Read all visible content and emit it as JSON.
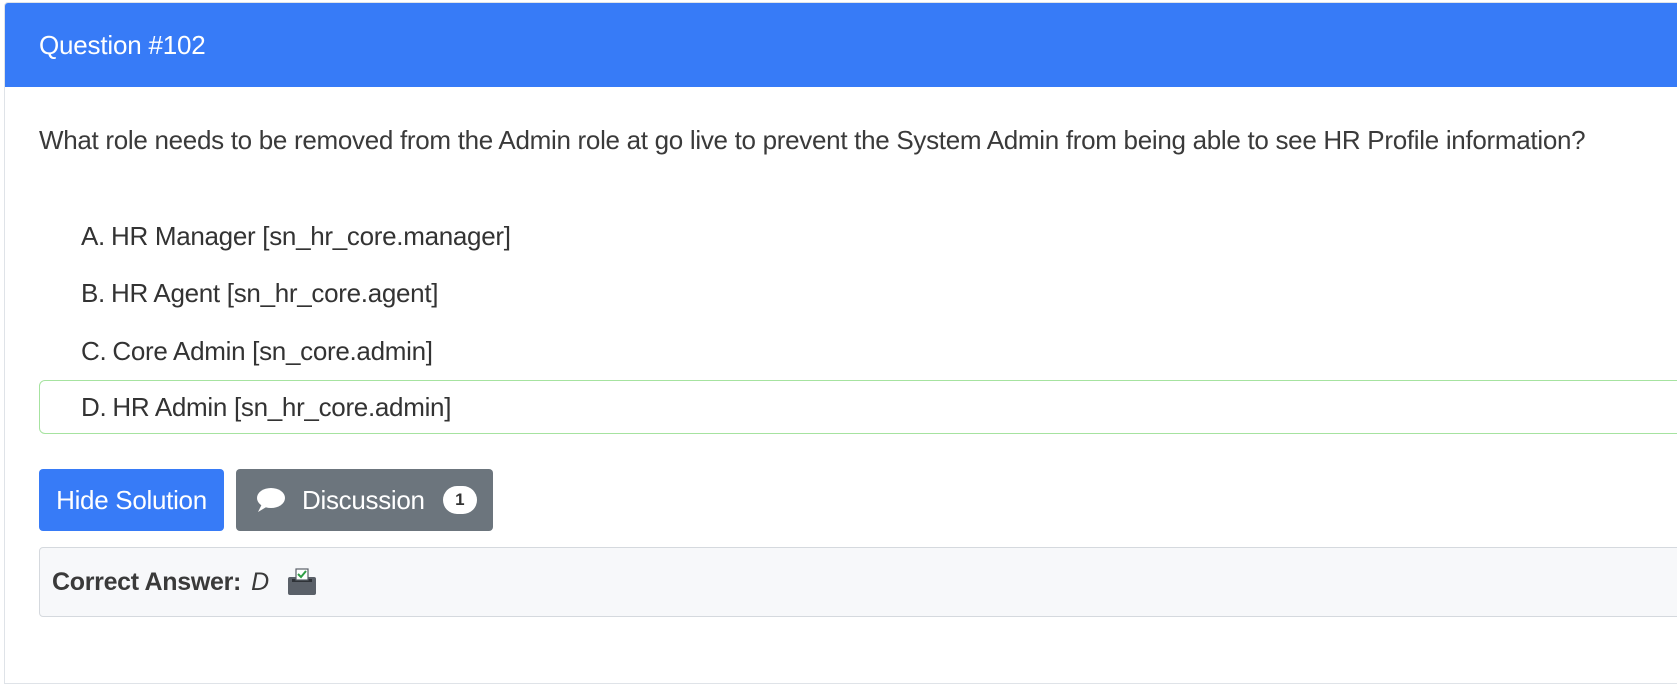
{
  "header": {
    "title": "Question #102"
  },
  "question": {
    "text": "What role needs to be removed from the Admin role at go live to prevent the System Admin from being able to see HR Profile information?"
  },
  "choices": [
    {
      "letter": "A.",
      "text": "HR Manager [sn_hr_core.manager]",
      "correct": false
    },
    {
      "letter": "B.",
      "text": "HR Agent [sn_hr_core.agent]",
      "correct": false
    },
    {
      "letter": "C.",
      "text": "Core Admin [sn_core.admin]",
      "correct": false
    },
    {
      "letter": "D.",
      "text": "HR Admin [sn_hr_core.admin]",
      "correct": true
    }
  ],
  "actions": {
    "hide_solution_label": "Hide Solution",
    "discussion_label": "Discussion",
    "discussion_count": "1"
  },
  "answer": {
    "label": "Correct Answer:",
    "value": "D"
  },
  "icons": {
    "discussion": "chat-bubble-icon",
    "vote": "ballot-box-icon"
  },
  "colors": {
    "primary": "#377bf7",
    "secondary": "#6c757d",
    "correct_border": "#a6e3a0"
  }
}
